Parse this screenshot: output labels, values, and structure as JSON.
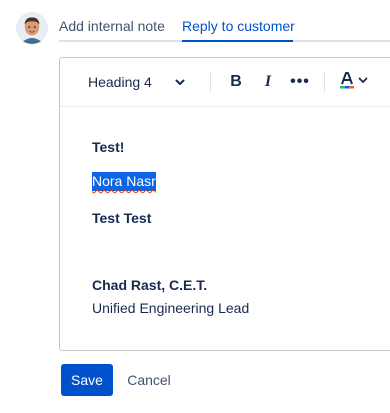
{
  "tabs": {
    "internal_note": "Add internal note",
    "reply_to_customer": "Reply to customer",
    "active": "reply_to_customer"
  },
  "toolbar": {
    "heading_value": "Heading 4",
    "bold_label": "B",
    "italic_label": "I",
    "more_label": "•••",
    "text_color_icon": "text-color-icon",
    "chevron_icon": "chevron-down-icon"
  },
  "content": {
    "line1": "Test!",
    "line2_selected": "Nora Nasr",
    "line3": "Test Test",
    "signature_name": "Chad Rast, C.E.T.",
    "signature_title": "Unified Engineering Lead"
  },
  "actions": {
    "save_label": "Save",
    "cancel_label": "Cancel"
  },
  "colors": {
    "accent": "#0052cc",
    "selection": "#0c66e4",
    "text": "#172b4d",
    "muted": "#42526e",
    "border": "#c1c7d0"
  }
}
